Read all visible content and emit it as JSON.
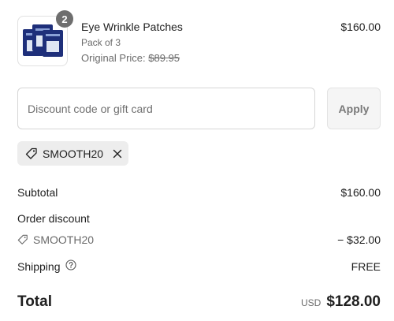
{
  "product": {
    "quantity": "2",
    "title": "Eye Wrinkle Patches",
    "variant": "Pack of 3",
    "original_price_label": "Original Price:",
    "original_price": "$89.95",
    "price": "$160.00"
  },
  "discount": {
    "placeholder": "Discount code or gift card",
    "apply_label": "Apply",
    "applied_code": "SMOOTH20"
  },
  "summary": {
    "subtotal_label": "Subtotal",
    "subtotal_value": "$160.00",
    "order_discount_label": "Order discount",
    "discount_code": "SMOOTH20",
    "discount_value": "− $32.00",
    "shipping_label": "Shipping",
    "shipping_value": "FREE",
    "total_label": "Total",
    "currency": "USD",
    "total_value": "$128.00"
  },
  "icons": {
    "tag": "tag-icon",
    "remove": "close-icon",
    "help": "question-circle-icon"
  },
  "colors": {
    "product_box": "#1e2f7a",
    "badge": "#6e6e6e",
    "chip_bg": "#ededed"
  }
}
